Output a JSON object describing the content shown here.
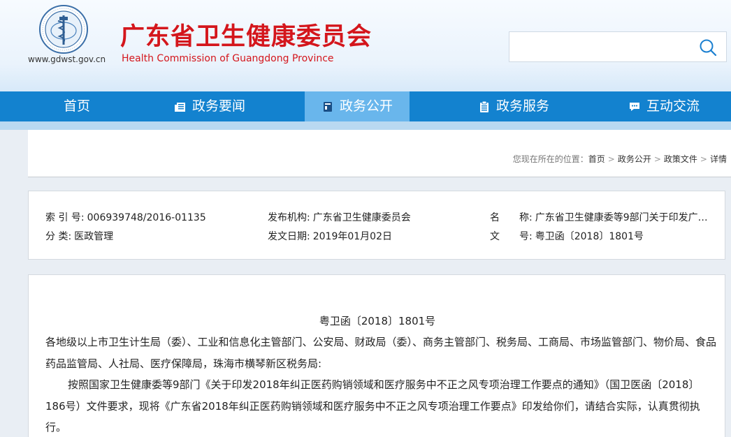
{
  "header": {
    "site_url": "www.gdwst.gov.cn",
    "title": "广东省卫生健康委员会",
    "subtitle": "Health Commission of Guangdong Province",
    "search_placeholder": ""
  },
  "nav": {
    "items": [
      {
        "label": "首页",
        "icon": "none"
      },
      {
        "label": "政务要闻",
        "icon": "newspaper-icon"
      },
      {
        "label": "政务公开",
        "icon": "book-icon"
      },
      {
        "label": "政务服务",
        "icon": "clipboard-icon"
      },
      {
        "label": "互动交流",
        "icon": "chat-icon"
      }
    ],
    "active_index": 2
  },
  "breadcrumb": {
    "lead": "您现在所在的位置：",
    "items": [
      "首页",
      "政务公开",
      "政策文件",
      "详情"
    ]
  },
  "meta": {
    "index_label": "索 引 号:",
    "index_value": "006939748/2016-01135",
    "category_label": "分 类:",
    "category_value": "医政管理",
    "publisher_label": "发布机构:",
    "publisher_value": "广东省卫生健康委员会",
    "date_label": "发文日期:",
    "date_value": "2019年01月02日",
    "name_label": "名　　称:",
    "name_value": "广东省卫生健康委等9部门关于印发广…",
    "docno_label": "文　　号:",
    "docno_value": "粤卫函〔2018〕1801号"
  },
  "document": {
    "number": "粤卫函〔2018〕1801号",
    "salutation": "各地级以上市卫生计生局（委）、工业和信息化主管部门、公安局、财政局（委）、商务主管部门、税务局、工商局、市场监管部门、物价局、食品药品监管局、人社局、医疗保障局，珠海市横琴新区税务局:",
    "paragraph": "按照国家卫生健康委等9部门《关于印发2018年纠正医药购销领域和医疗服务中不正之风专项治理工作要点的通知》（国卫医函〔2018〕186号）文件要求，现将《广东省2018年纠正医药购销领域和医疗服务中不正之风专项治理工作要点》印发给你们，请结合实际，认真贯彻执行。"
  },
  "colors": {
    "brand_red": "#d4161c",
    "nav_blue": "#1382cf",
    "nav_active": "#69b6ec"
  }
}
